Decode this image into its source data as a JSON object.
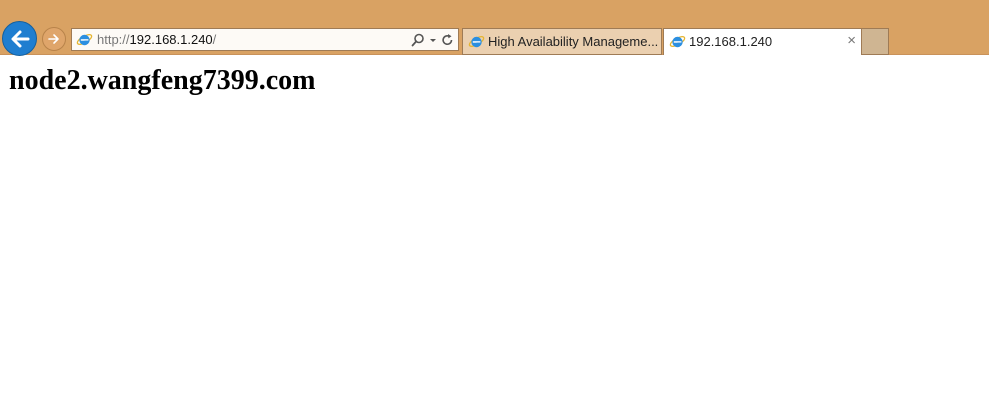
{
  "browser": {
    "address_bar": {
      "protocol": "http://",
      "host": "192.168.1.240",
      "path": "/",
      "icon": "ie-logo-icon"
    },
    "tabs": [
      {
        "label": "High Availability Manageme...",
        "icon": "ie-logo-icon",
        "active": false
      },
      {
        "label": "192.168.1.240",
        "icon": "ie-logo-icon",
        "active": true,
        "close_label": "×"
      }
    ],
    "nav_icons": [
      "back-arrow-icon",
      "forward-arrow-icon",
      "search-icon",
      "dropdown-icon",
      "refresh-icon"
    ],
    "colors": {
      "frame": "#d9a263",
      "back_button": "#1f7ed0"
    }
  },
  "page": {
    "heading": "node2.wangfeng7399.com"
  }
}
